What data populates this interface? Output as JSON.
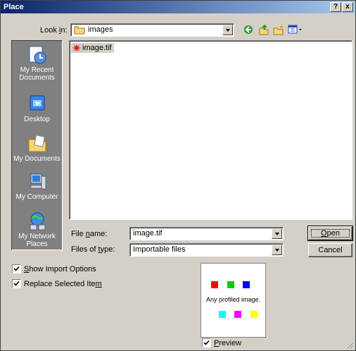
{
  "window": {
    "title": "Place",
    "help_label": "?",
    "close_label": "x"
  },
  "look_in": {
    "label_pre": "Look ",
    "label_mnemonic": "i",
    "label_post": "n:",
    "value": "images"
  },
  "toolbar": {
    "icons": [
      "back-icon",
      "up-folder-icon",
      "new-folder-icon",
      "view-menu-icon"
    ]
  },
  "places": [
    {
      "label": "My Recent Documents",
      "icon": "recent-documents-icon"
    },
    {
      "label": "Desktop",
      "icon": "desktop-icon"
    },
    {
      "label": "My Documents",
      "icon": "my-documents-icon"
    },
    {
      "label": "My Computer",
      "icon": "my-computer-icon"
    },
    {
      "label": "My Network Places",
      "icon": "network-places-icon"
    }
  ],
  "files": [
    {
      "name": "image.tif",
      "icon": "tif-file-icon"
    }
  ],
  "file_name": {
    "label_pre": "File ",
    "label_mnemonic": "n",
    "label_post": "ame:",
    "value": "image.tif"
  },
  "files_of_type": {
    "label_pre": "Files of ",
    "label_mnemonic": "t",
    "label_post": "ype:",
    "value": "Importable files"
  },
  "buttons": {
    "open_mnemonic": "O",
    "open_rest": "pen",
    "cancel": "Cancel"
  },
  "options": {
    "show_import": {
      "pre": "",
      "mnemonic": "S",
      "post": "how Import Options",
      "checked": true
    },
    "replace_selected": {
      "pre": "Replace Selected Ite",
      "mnemonic": "m",
      "post": "",
      "checked": true
    }
  },
  "preview": {
    "caption": "Any profiled image.",
    "checkbox_mnemonic": "P",
    "checkbox_rest": "review",
    "checked": true,
    "top_colors": [
      "#ff0000",
      "#00cc00",
      "#0000ff"
    ],
    "bottom_colors": [
      "#00ffff",
      "#ff00ff",
      "#ffff00"
    ]
  }
}
